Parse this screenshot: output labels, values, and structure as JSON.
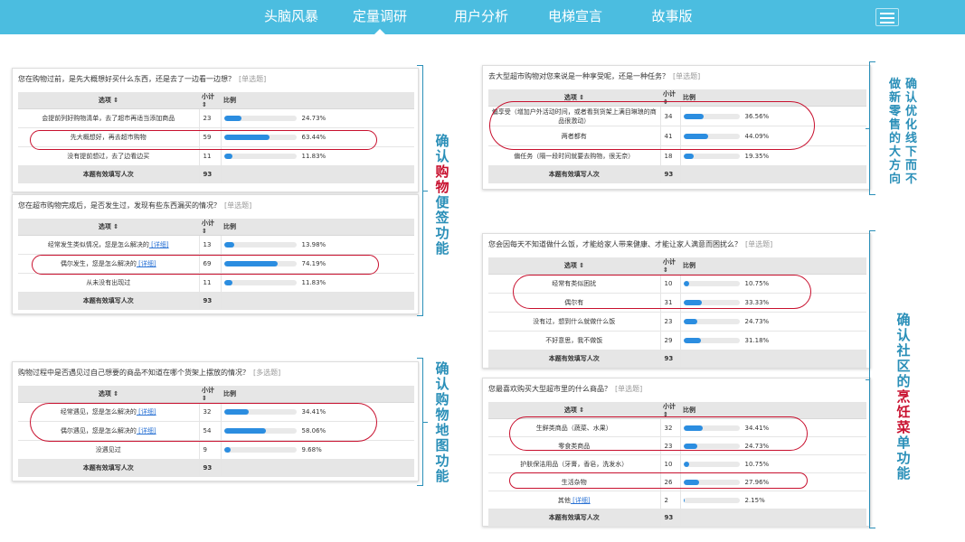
{
  "nav": {
    "items": [
      {
        "label": "头脑风暴"
      },
      {
        "label": "定量调研"
      },
      {
        "label": "用户分析"
      },
      {
        "label": "电梯宣言"
      },
      {
        "label": "故事版"
      }
    ],
    "active_index": 1
  },
  "colors": {
    "topbar": "#4bbde0",
    "bar": "#2b8de0",
    "highlight": "#c8102e",
    "annotation": "#2a8fb8"
  },
  "table_header": {
    "option": "选项 ⇕",
    "count": "小计⇕",
    "ratio": "比例"
  },
  "questions": [
    {
      "title": "您在购物过前，是先大概想好买什么东西，还是去了一边看一边想？",
      "type": "[单选题]",
      "rows": [
        {
          "option": "会提前列好购物清单，去了超市再适当添加商品",
          "count": "23",
          "percent": 24.73,
          "percent_label": "24.73%"
        },
        {
          "option": "先大概想好，再去超市购物",
          "count": "59",
          "percent": 63.44,
          "percent_label": "63.44%"
        },
        {
          "option": "没有提前想过，去了边看边买",
          "count": "11",
          "percent": 11.83,
          "percent_label": "11.83%"
        }
      ],
      "footer": {
        "label": "本题有效填写人次",
        "count": "93"
      }
    },
    {
      "title": "您在超市购物完成后，是否发生过，发现有些东西漏买的情况？",
      "type": "[单选题]",
      "rows": [
        {
          "option": "经常发生类似情况，您是怎么解决的",
          "link": "[详细]",
          "count": "13",
          "percent": 13.98,
          "percent_label": "13.98%"
        },
        {
          "option": "偶尔发生，您是怎么解决的",
          "link": "[详细]",
          "count": "69",
          "percent": 74.19,
          "percent_label": "74.19%"
        },
        {
          "option": "从未没有出现过",
          "count": "11",
          "percent": 11.83,
          "percent_label": "11.83%"
        }
      ],
      "footer": {
        "label": "本题有效填写人次",
        "count": "93"
      }
    },
    {
      "title": "购物过程中是否遇见过自己想要的商品不知道在哪个货架上摆放的情况？",
      "type": "[多选题]",
      "rows": [
        {
          "option": "经常遇见，您是怎么解决的",
          "link": "[详细]",
          "count": "32",
          "percent": 34.41,
          "percent_label": "34.41%"
        },
        {
          "option": "偶尔遇见，您是怎么解决的",
          "link": "[详细]",
          "count": "54",
          "percent": 58.06,
          "percent_label": "58.06%"
        },
        {
          "option": "没遇见过",
          "count": "9",
          "percent": 9.68,
          "percent_label": "9.68%"
        }
      ],
      "footer": {
        "label": "本题有效填写人次",
        "count": "93"
      }
    },
    {
      "title": "去大型超市购物对您来说是一种享受呢，还是一种任务？",
      "type": "[单选题]",
      "rows": [
        {
          "option": "偏享受（增加户外活动时间，或者看到货架上满目琳琅的商品很激动）",
          "count": "34",
          "percent": 36.56,
          "percent_label": "36.56%"
        },
        {
          "option": "两者都有",
          "count": "41",
          "percent": 44.09,
          "percent_label": "44.09%"
        },
        {
          "option": "偏任务（隔一段时间就要去购物，很无奈）",
          "count": "18",
          "percent": 19.35,
          "percent_label": "19.35%"
        }
      ],
      "footer": {
        "label": "本题有效填写人次",
        "count": "93"
      }
    },
    {
      "title": "您会因每天不知道做什么饭，才能给家人带来健康、才能让家人满意而困扰么？",
      "type": "[单选题]",
      "rows": [
        {
          "option": "经常有类似困扰",
          "count": "10",
          "percent": 10.75,
          "percent_label": "10.75%"
        },
        {
          "option": "偶尔有",
          "count": "31",
          "percent": 33.33,
          "percent_label": "33.33%"
        },
        {
          "option": "没有过，想到什么就做什么饭",
          "count": "23",
          "percent": 24.73,
          "percent_label": "24.73%"
        },
        {
          "option": "不好意思，我不做饭",
          "count": "29",
          "percent": 31.18,
          "percent_label": "31.18%"
        }
      ],
      "footer": {
        "label": "本题有效填写人次",
        "count": "93"
      }
    },
    {
      "title": "您最喜欢购买大型超市里的什么商品？",
      "type": "[单选题]",
      "rows": [
        {
          "option": "生鲜类商品（蔬菜、水果）",
          "count": "32",
          "percent": 34.41,
          "percent_label": "34.41%"
        },
        {
          "option": "零食类商品",
          "count": "23",
          "percent": 24.73,
          "percent_label": "24.73%"
        },
        {
          "option": "护肤保洁用品（牙膏，香皂，洗发水）",
          "count": "10",
          "percent": 10.75,
          "percent_label": "10.75%"
        },
        {
          "option": "生活杂物",
          "count": "26",
          "percent": 27.96,
          "percent_label": "27.96%"
        },
        {
          "option": "其他",
          "link": "[详细]",
          "count": "2",
          "percent": 2.15,
          "percent_label": "2.15%"
        }
      ],
      "footer": {
        "label": "本题有效填写人次",
        "count": "93"
      }
    }
  ],
  "annotations": {
    "a1": "确认购物便签功能",
    "a2": "确认购物地图功能",
    "a3": "确认优化线下而不做新零售的大方向",
    "a4": "确认社区的烹饪菜单功能"
  }
}
